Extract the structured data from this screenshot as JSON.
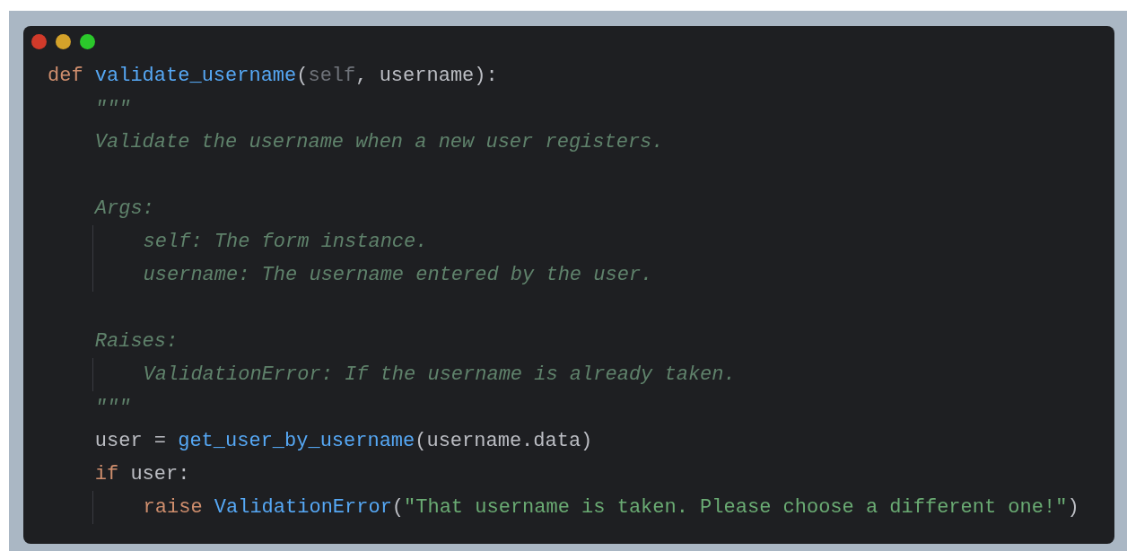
{
  "window": {
    "controls": [
      {
        "color": "#d13a2a"
      },
      {
        "color": "#d4a22a"
      },
      {
        "color": "#2bc82b"
      }
    ]
  },
  "code": {
    "lines": [
      {
        "kind": "code",
        "tokens": [
          {
            "text": "def ",
            "kind": "keyword"
          },
          {
            "text": "validate_username",
            "kind": "function"
          },
          {
            "text": "(",
            "kind": "plain"
          },
          {
            "text": "self",
            "kind": "self"
          },
          {
            "text": ", username):",
            "kind": "plain"
          }
        ],
        "children": [
          {
            "kind": "code",
            "tokens": [
              {
                "text": "\"\"\"",
                "kind": "docstring"
              }
            ]
          },
          {
            "kind": "code",
            "tokens": [
              {
                "text": "Validate the username when a new user registers.",
                "kind": "docstring"
              }
            ]
          },
          {
            "kind": "blank"
          },
          {
            "kind": "code",
            "tokens": [
              {
                "text": "Args:",
                "kind": "docstring"
              }
            ],
            "children": [
              {
                "kind": "code",
                "tokens": [
                  {
                    "text": "self: The form instance.",
                    "kind": "docstring"
                  }
                ]
              },
              {
                "kind": "code",
                "tokens": [
                  {
                    "text": "username: The username entered by the user.",
                    "kind": "docstring"
                  }
                ]
              }
            ]
          },
          {
            "kind": "blank"
          },
          {
            "kind": "code",
            "tokens": [
              {
                "text": "Raises:",
                "kind": "docstring"
              }
            ],
            "children": [
              {
                "kind": "code",
                "tokens": [
                  {
                    "text": "ValidationError: If the username is already taken.",
                    "kind": "docstring"
                  }
                ]
              }
            ]
          },
          {
            "kind": "code",
            "tokens": [
              {
                "text": "\"\"\"",
                "kind": "docstring"
              }
            ]
          },
          {
            "kind": "code",
            "tokens": [
              {
                "text": "user = ",
                "kind": "plain"
              },
              {
                "text": "get_user_by_username",
                "kind": "function"
              },
              {
                "text": "(username.data)",
                "kind": "plain"
              }
            ]
          },
          {
            "kind": "code",
            "tokens": [
              {
                "text": "if",
                "kind": "keyword"
              },
              {
                "text": " user:",
                "kind": "plain"
              }
            ],
            "children": [
              {
                "kind": "code",
                "tokens": [
                  {
                    "text": "raise ",
                    "kind": "keyword"
                  },
                  {
                    "text": "ValidationError",
                    "kind": "function"
                  },
                  {
                    "text": "(",
                    "kind": "plain"
                  },
                  {
                    "text": "\"That username is taken. Please choose a different one!\"",
                    "kind": "string"
                  },
                  {
                    "text": ")",
                    "kind": "plain"
                  }
                ]
              }
            ]
          }
        ]
      }
    ]
  }
}
